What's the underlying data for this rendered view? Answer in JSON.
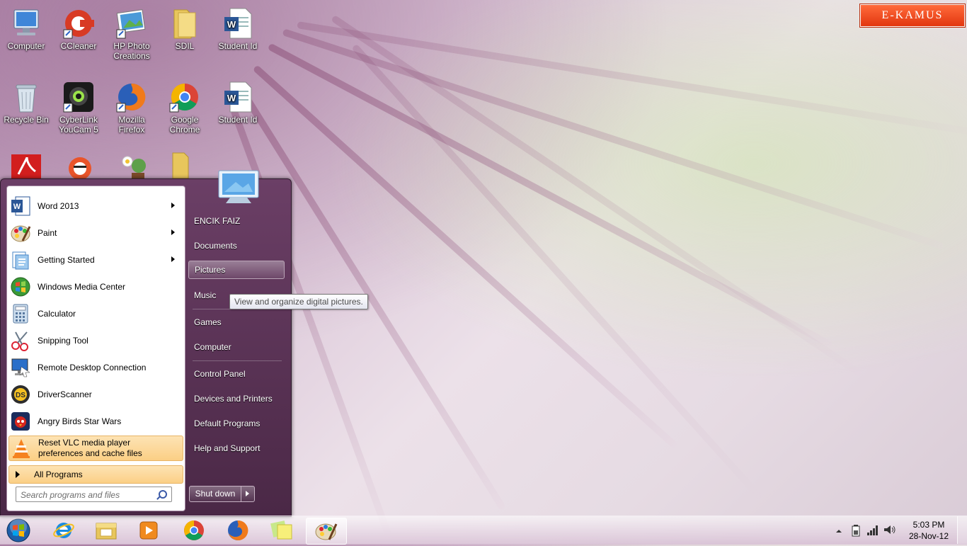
{
  "desktop": {
    "icons": [
      {
        "label": "Computer",
        "icon": "computer-icon"
      },
      {
        "label": "CCleaner",
        "icon": "ccleaner-icon"
      },
      {
        "label": "HP Photo Creations",
        "icon": "hp-photo-icon"
      },
      {
        "label": "SDIL",
        "icon": "folder-icon"
      },
      {
        "label": "Student Id",
        "icon": "word-document-icon"
      },
      {
        "label": "Recycle Bin",
        "icon": "recycle-bin-icon"
      },
      {
        "label": "CyberLink YouCam 5",
        "icon": "youcam-icon"
      },
      {
        "label": "Mozilla Firefox",
        "icon": "firefox-icon"
      },
      {
        "label": "Google Chrome",
        "icon": "chrome-icon"
      },
      {
        "label": "Student Id",
        "icon": "word-document-icon"
      }
    ],
    "badge": "E-KAMUS"
  },
  "start_menu": {
    "programs": [
      {
        "label": "Word 2013",
        "icon": "word-icon",
        "submenu": true
      },
      {
        "label": "Paint",
        "icon": "paint-icon",
        "submenu": true
      },
      {
        "label": "Getting Started",
        "icon": "getting-started-icon",
        "submenu": true
      },
      {
        "label": "Windows Media Center",
        "icon": "media-center-icon",
        "submenu": false
      },
      {
        "label": "Calculator",
        "icon": "calculator-icon",
        "submenu": false
      },
      {
        "label": "Snipping Tool",
        "icon": "scissors-icon",
        "submenu": false
      },
      {
        "label": "Remote Desktop Connection",
        "icon": "remote-desktop-icon",
        "submenu": false
      },
      {
        "label": "DriverScanner",
        "icon": "driverscanner-icon",
        "submenu": false
      },
      {
        "label": "Angry Birds Star Wars",
        "icon": "angry-birds-icon",
        "submenu": false
      }
    ],
    "highlighted_program": {
      "label_line1": "Reset VLC media player",
      "label_line2": "preferences and cache files",
      "icon": "vlc-icon"
    },
    "all_programs": "All Programs",
    "search_placeholder": "Search programs and files",
    "right_items": [
      {
        "label": "ENCIK FAIZ"
      },
      {
        "label": "Documents"
      },
      {
        "label": "Pictures"
      },
      {
        "label": "Music"
      },
      {
        "label": "Games"
      },
      {
        "label": "Computer"
      },
      {
        "label": "Control Panel"
      },
      {
        "label": "Devices and Printers"
      },
      {
        "label": "Default Programs"
      },
      {
        "label": "Help and Support"
      }
    ],
    "hovered_item": "Pictures",
    "tooltip": "View and organize digital pictures.",
    "shutdown": "Shut down"
  },
  "taskbar": {
    "pinned": [
      "internet-explorer-icon",
      "windows-explorer-icon",
      "media-player-icon",
      "chrome-icon",
      "firefox-icon",
      "sticky-notes-icon",
      "paint-icon"
    ],
    "active": "paint-icon",
    "tray_icons": [
      "show-hidden-icons-icon",
      "battery-icon",
      "signal-icon",
      "volume-icon"
    ],
    "time": "5:03 PM",
    "date": "28-Nov-12"
  },
  "colors": {
    "menu_bg": "#5c3457",
    "highlight": "#fbcf85",
    "badge": "#e2370f"
  }
}
